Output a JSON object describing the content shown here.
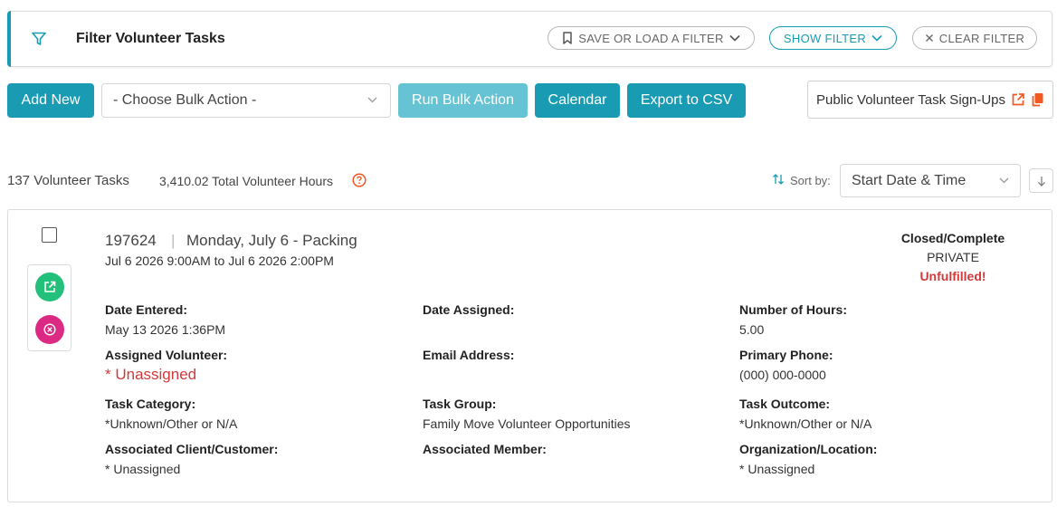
{
  "filter": {
    "title": "Filter Volunteer Tasks",
    "save_load_label": "SAVE OR LOAD A FILTER",
    "show_filter_label": "SHOW FILTER",
    "clear_filter_label": "CLEAR FILTER"
  },
  "toolbar": {
    "add_new_label": "Add New",
    "bulk_action_selected": "- Choose Bulk Action -",
    "run_bulk_label": "Run Bulk Action",
    "calendar_label": "Calendar",
    "export_label": "Export to CSV",
    "public_signups_label": "Public Volunteer Task Sign-Ups"
  },
  "summary": {
    "task_count": "137 Volunteer Tasks",
    "total_hours": "3,410.02 Total Volunteer Hours",
    "sort_label": "Sort by:",
    "sort_selected": "Start Date & Time"
  },
  "task": {
    "id": "197624",
    "separator": "|",
    "title": "Monday, July 6 - Packing",
    "date_range": "Jul 6 2026 9:00AM to Jul 6 2026 2:00PM",
    "status": "Closed/Complete",
    "visibility": "PRIVATE",
    "fulfillment": "Unfulfilled!",
    "fields": {
      "date_entered": {
        "label": "Date Entered:",
        "value": "May 13 2026 1:36PM"
      },
      "date_assigned": {
        "label": "Date Assigned:",
        "value": ""
      },
      "number_of_hours": {
        "label": "Number of Hours:",
        "value": "5.00"
      },
      "assigned_volunteer": {
        "label": "Assigned Volunteer:",
        "value": "* Unassigned"
      },
      "email_address": {
        "label": "Email Address:",
        "value": ""
      },
      "primary_phone": {
        "label": "Primary Phone:",
        "value": "(000) 000-0000"
      },
      "task_category": {
        "label": "Task Category:",
        "value": "*Unknown/Other or N/A"
      },
      "task_group": {
        "label": "Task Group:",
        "value": "Family Move Volunteer Opportunities"
      },
      "task_outcome": {
        "label": "Task Outcome:",
        "value": "*Unknown/Other or N/A"
      },
      "associated_client": {
        "label": "Associated Client/Customer:",
        "value": "* Unassigned"
      },
      "associated_member": {
        "label": "Associated Member:",
        "value": ""
      },
      "organization_location": {
        "label": "Organization/Location:",
        "value": "* Unassigned"
      }
    }
  },
  "colors": {
    "primary": "#1a9bb4",
    "primary_disabled": "#66c3d3",
    "danger_text": "#d03a3a",
    "open_button": "#22c07a",
    "delete_button": "#dc2a84",
    "orange_icon": "#f05a22"
  }
}
